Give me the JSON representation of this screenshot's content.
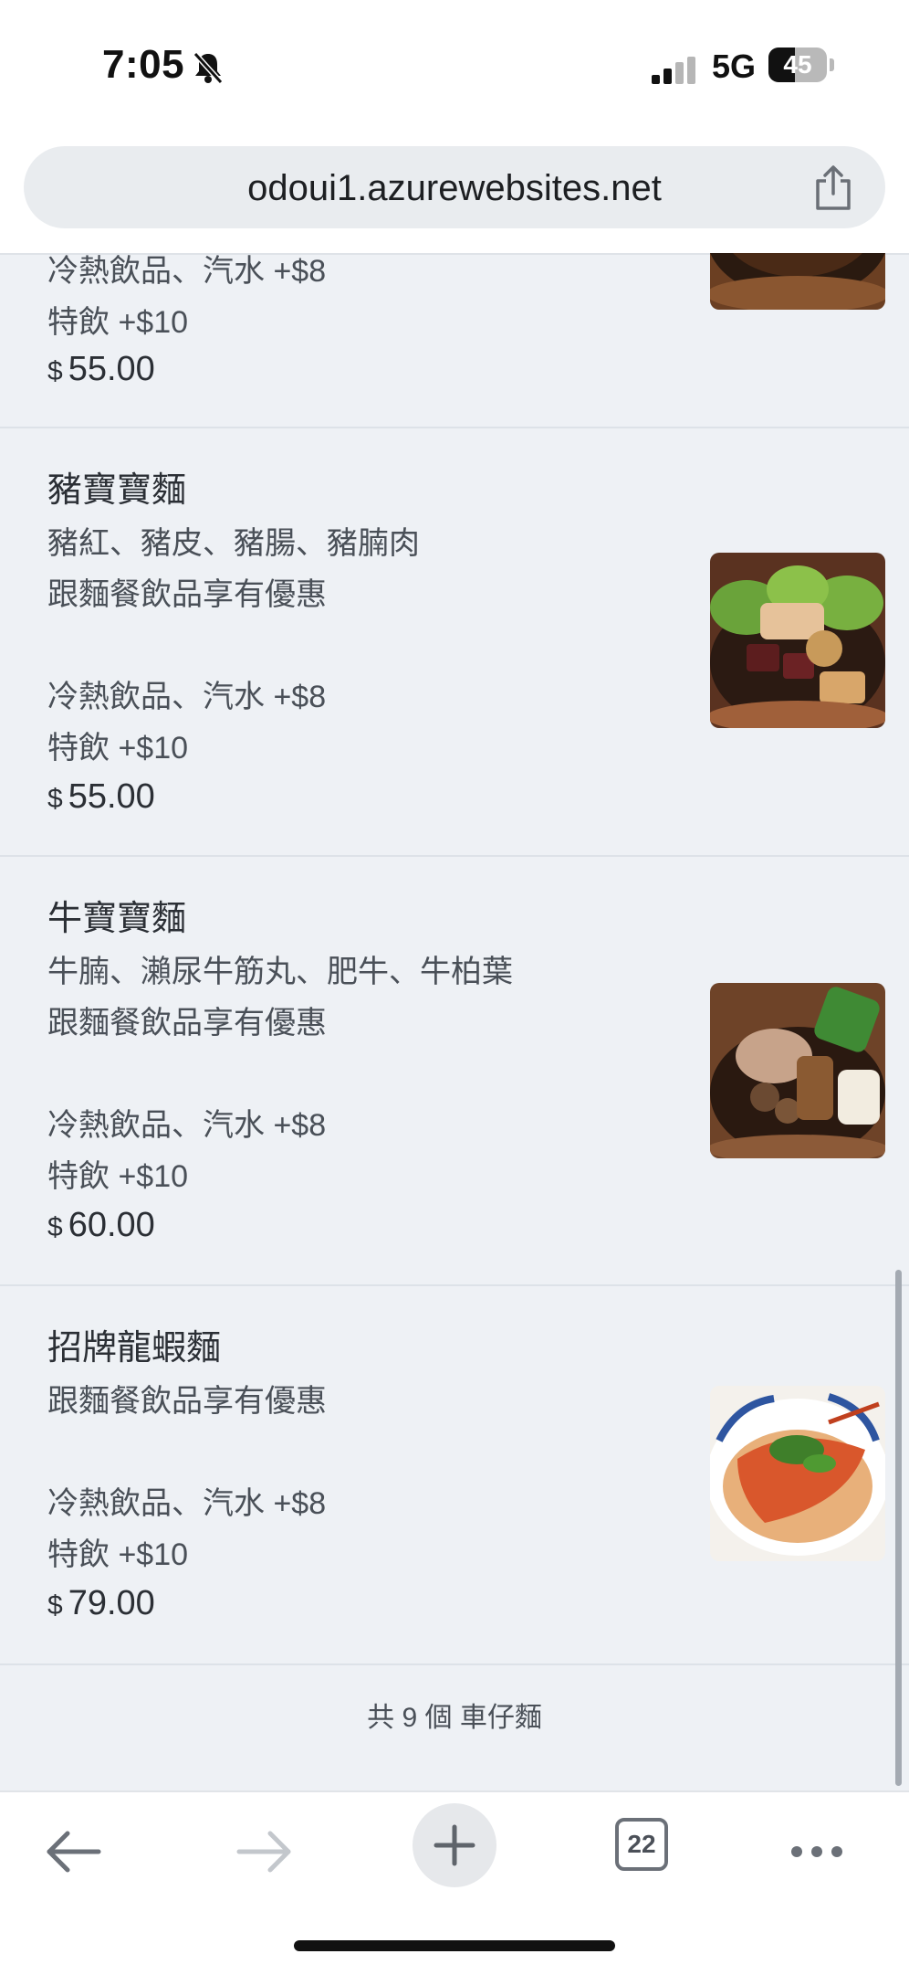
{
  "status_bar": {
    "time": "7:05",
    "network": "5G",
    "battery": "45",
    "battery_level": 0.45,
    "icons": [
      "bell-slash-icon",
      "cellular-signal-icon",
      "battery-icon"
    ]
  },
  "address_bar": {
    "url": "odoui1.azurewebsites.net",
    "share_icon": "share-icon"
  },
  "menu": {
    "items": [
      {
        "name": "",
        "lines": [
          "冷熱飲品、汽水 +$8",
          "特飲 +$10"
        ],
        "currency": "$",
        "price": "55.00",
        "image": "noodle-bowl-photo"
      },
      {
        "name": "豬寶寶麵",
        "lines": [
          "豬紅、豬皮、豬腸、豬腩肉",
          "跟麵餐飲品享有優惠",
          "冷熱飲品、汽水 +$8",
          "特飲 +$10"
        ],
        "currency": "$",
        "price": "55.00",
        "image": "pork-offal-noodle-photo"
      },
      {
        "name": "牛寶寶麵",
        "lines": [
          "牛腩、瀨尿牛筋丸、肥牛、牛柏葉",
          "跟麵餐飲品享有優惠",
          "冷熱飲品、汽水 +$8",
          "特飲 +$10"
        ],
        "currency": "$",
        "price": "60.00",
        "image": "beef-noodle-photo"
      },
      {
        "name": "招牌龍蝦麵",
        "lines": [
          "跟麵餐飲品享有優惠",
          "冷熱飲品、汽水 +$8",
          "特飲 +$10"
        ],
        "currency": "$",
        "price": "79.00",
        "image": "lobster-noodle-photo"
      }
    ],
    "footer": "共 9 個 車仔麵"
  },
  "toolbar": {
    "tab_count": "22",
    "icons": [
      "back-arrow-icon",
      "forward-arrow-icon",
      "plus-icon",
      "tabs-icon",
      "more-icon"
    ]
  },
  "colors": {
    "page_bg": "#eef1f5",
    "text": "#2b2f35",
    "divider": "#dde2e8"
  }
}
